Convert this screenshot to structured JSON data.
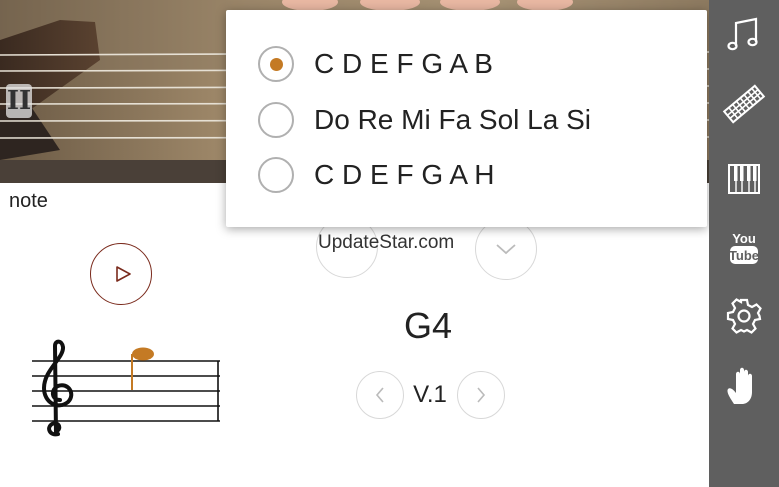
{
  "header": {
    "pause_glyph": "II"
  },
  "note_display": {
    "label": "note",
    "value": "G4",
    "version": "V.1"
  },
  "watermark": "UpdateStar.com",
  "notation_dropdown": {
    "selected_index": 0,
    "options": [
      {
        "label": "C D E F G A B"
      },
      {
        "label": "Do Re Mi Fa Sol La Si"
      },
      {
        "label": "C D E F G A H"
      }
    ]
  },
  "sidebar": {
    "icons": [
      "music-note-icon",
      "guitar-neck-icon",
      "piano-keys-icon",
      "youtube-icon",
      "gear-icon",
      "hand-icon"
    ]
  },
  "colors": {
    "accent": "#c47a24",
    "sidebar_bg": "#5f5f5f",
    "play_ring": "#7a2a1c"
  }
}
